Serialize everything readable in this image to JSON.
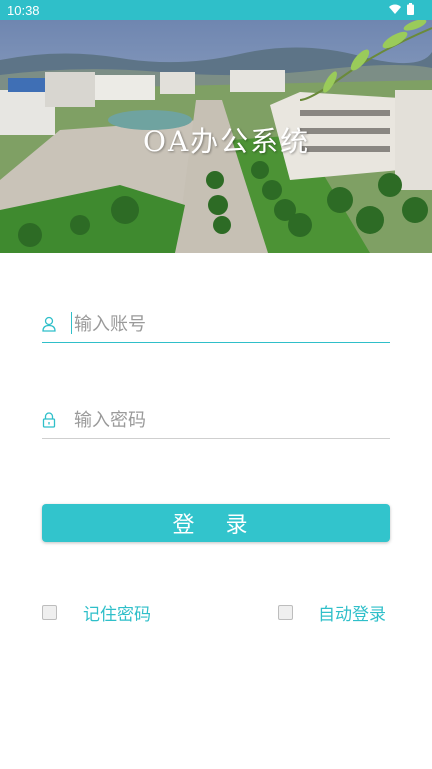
{
  "status_bar": {
    "time": "10:38",
    "wifi_icon": "wifi-icon",
    "battery_icon": "battery-icon"
  },
  "banner": {
    "title": "OA办公系统",
    "image": "campus-aerial-photo"
  },
  "form": {
    "account": {
      "placeholder": "输入账号",
      "value": "",
      "icon": "user-icon"
    },
    "password": {
      "placeholder": "输入密码",
      "value": "",
      "icon": "lock-icon"
    }
  },
  "login_button": {
    "label": "登 录"
  },
  "options": {
    "remember_password": {
      "label": "记住密码",
      "checked": false
    },
    "auto_login": {
      "label": "自动登录",
      "checked": false
    }
  },
  "colors": {
    "accent": "#2fbfc9",
    "button": "#32c4cc"
  }
}
